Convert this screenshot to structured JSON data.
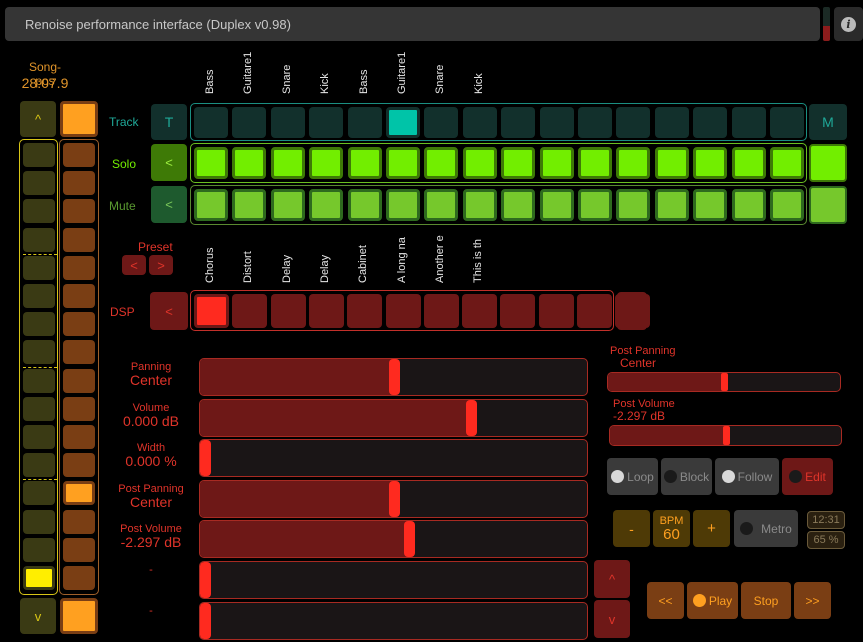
{
  "title": "Renoise performance interface (Duplex v0.98)",
  "output_meter_level": 0.45,
  "song_position": {
    "label": "Song-pos",
    "value": "28:07.9"
  },
  "left_nav": {
    "up_label": "^",
    "down_label": "v",
    "yellow_column_active_index": 15,
    "orange_column_active_index": 12,
    "cell_count": 16
  },
  "track_names": [
    "Bass",
    "Guitare1",
    "Snare",
    "Kick",
    "Bass",
    "Guitare1",
    "Snare",
    "Kick",
    "",
    "",
    "",
    "",
    "",
    "",
    "",
    ""
  ],
  "rows": {
    "track": {
      "label": "Track",
      "left_button": "T",
      "right_button": "M",
      "selected_index": 5
    },
    "solo": {
      "label": "Solo",
      "left_button": "<"
    },
    "mute": {
      "label": "Mute",
      "left_button": "<"
    }
  },
  "preset": {
    "label": "Preset",
    "prev": "<",
    "next": ">"
  },
  "dsp": {
    "label": "DSP",
    "prev": "<",
    "next": ">",
    "devices": [
      "Chorus",
      "Distort",
      "Delay",
      "Delay",
      "Cabinet",
      "A long na",
      "Another e",
      "This is th",
      "",
      "",
      "",
      ""
    ],
    "selected_index": 0
  },
  "parameters": [
    {
      "name": "Panning",
      "value": "Center",
      "fraction": 0.5
    },
    {
      "name": "Volume",
      "value": "0.000 dB",
      "fraction": 0.7
    },
    {
      "name": "Width",
      "value": "0.000 %",
      "fraction": 0.0
    },
    {
      "name": "Post Panning",
      "value": "Center",
      "fraction": 0.5
    },
    {
      "name": "Post Volume",
      "value": "-2.297 dB",
      "fraction": 0.54
    },
    {
      "name": "-",
      "value": "",
      "fraction": 0.0
    },
    {
      "name": "-",
      "value": "",
      "fraction": 0.0
    }
  ],
  "param_page": {
    "up": "^",
    "down": "v"
  },
  "master": {
    "post_panning": {
      "name": "Post Panning",
      "value": "Center",
      "fraction": 0.5
    },
    "post_volume": {
      "name": "Post Volume",
      "value": "-2.297 dB",
      "fraction": 0.5
    }
  },
  "toggles": [
    {
      "label": "Loop",
      "on": true
    },
    {
      "label": "Block",
      "on": false
    },
    {
      "label": "Follow",
      "on": true
    },
    {
      "label": "Edit",
      "on": false
    }
  ],
  "bpm": {
    "dec": "-",
    "label": "BPM",
    "value": "60",
    "inc": "+"
  },
  "metro": {
    "label": "Metro",
    "on": false
  },
  "clock": "12:31",
  "cpu": "65 %",
  "transport": {
    "rewind": "<<",
    "play": "Play",
    "stop": "Stop",
    "forward": ">>"
  },
  "colors": {
    "track": "#1a8f82",
    "track_selected": "#00c4a8",
    "solo": "#72ee00",
    "mute": "#76c82c",
    "dsp_selected": "#ff2a1f",
    "dsp_cell": "#6e1817",
    "transport": "#7a3e14",
    "bpm": "#4e3a06"
  }
}
